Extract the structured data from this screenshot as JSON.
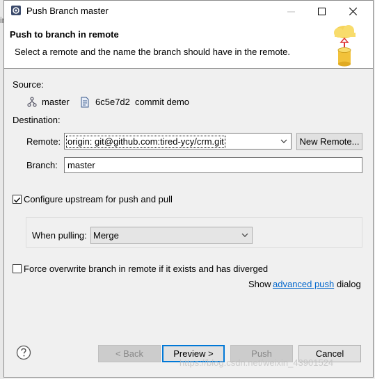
{
  "window": {
    "title": "Push Branch master",
    "behind_text": "ir"
  },
  "banner": {
    "title": "Push to branch in remote",
    "description": "Select a remote and the name the branch should have in the remote."
  },
  "source": {
    "label": "Source:",
    "branch": "master",
    "commit_id": "6c5e7d2",
    "commit_message": "commit demo"
  },
  "destination": {
    "label": "Destination:",
    "remote_label": "Remote:",
    "remote_value": "origin: git@github.com:tired-ycy/crm.git",
    "new_remote_button": "New Remote...",
    "branch_label": "Branch:",
    "branch_value": "master"
  },
  "upstream": {
    "checked": true,
    "label": "Configure upstream for push and pull",
    "when_pulling_label": "When pulling:",
    "when_pulling_value": "Merge"
  },
  "force": {
    "checked": false,
    "label": "Force overwrite branch in remote if it exists and has diverged"
  },
  "advanced": {
    "prefix": "Show",
    "link": "advanced push",
    "suffix": "dialog"
  },
  "footer": {
    "back": "< Back",
    "preview": "Preview >",
    "push": "Push",
    "cancel": "Cancel",
    "watermark": "https://blog.csdn.net/weixin_43901524"
  },
  "colors": {
    "link": "#0066cc",
    "default_button_border": "#0078d7"
  },
  "icons": {
    "app": "git-push-icon",
    "branch": "branch-icon",
    "commit": "commit-icon",
    "banner": "cloud-push-icon",
    "help": "help-icon"
  }
}
